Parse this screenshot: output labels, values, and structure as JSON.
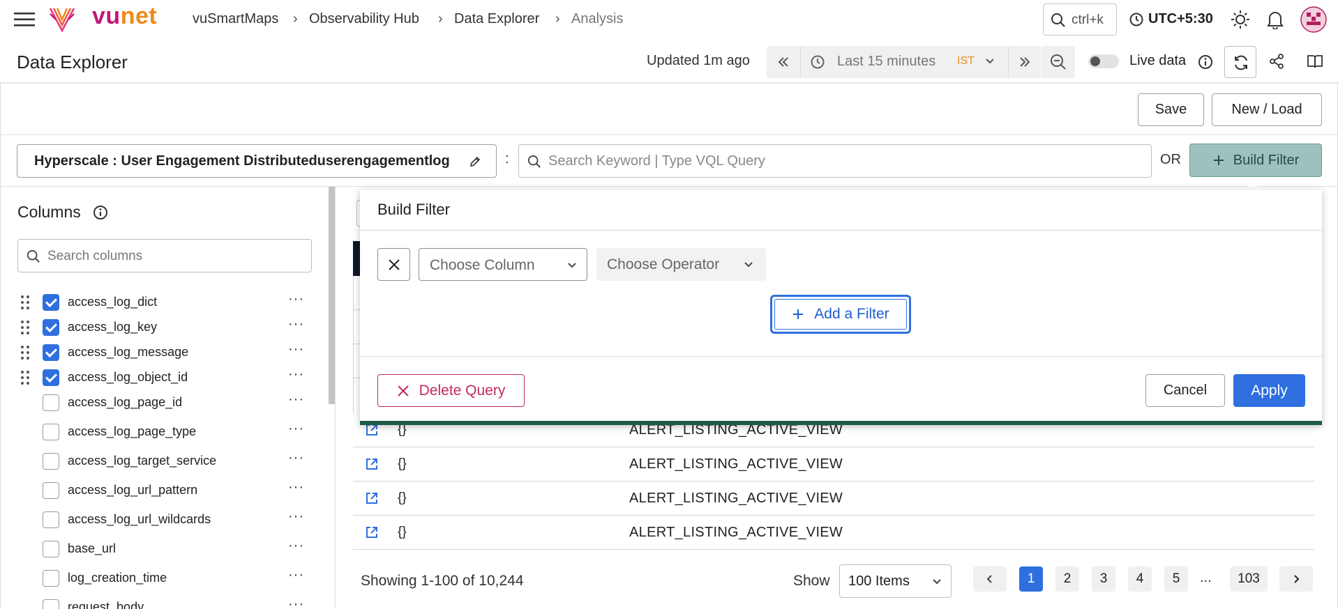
{
  "app": {
    "logo": "vunet",
    "breadcrumb": [
      "vuSmartMaps",
      "Observability Hub",
      "Data Explorer",
      "Analysis"
    ],
    "search_shortcut": "ctrl+k",
    "timezone": "UTC+5:30"
  },
  "header": {
    "title": "Data Explorer",
    "updated": "Updated 1m ago",
    "time_range": "Last 15 minutes",
    "tz_badge": "IST",
    "live_data_label": "Live data"
  },
  "toolbar": {
    "save_label": "Save",
    "new_load_label": "New / Load"
  },
  "query": {
    "datasource": "Hyperscale : User Engagement Distributeduserengagementlog",
    "separator": ":",
    "search_placeholder": "Search Keyword | Type VQL Query",
    "or_label": "OR",
    "build_filter_label": "Build Filter"
  },
  "sidebar": {
    "title": "Columns",
    "search_placeholder": "Search columns",
    "columns": [
      {
        "name": "access_log_dict",
        "checked": true
      },
      {
        "name": "access_log_key",
        "checked": true
      },
      {
        "name": "access_log_message",
        "checked": true
      },
      {
        "name": "access_log_object_id",
        "checked": true
      },
      {
        "name": "access_log_page_id",
        "checked": false
      },
      {
        "name": "access_log_page_type",
        "checked": false
      },
      {
        "name": "access_log_target_service",
        "checked": false
      },
      {
        "name": "access_log_url_pattern",
        "checked": false
      },
      {
        "name": "access_log_url_wildcards",
        "checked": false
      },
      {
        "name": "base_url",
        "checked": false
      },
      {
        "name": "log_creation_time",
        "checked": false
      },
      {
        "name": "request_body",
        "checked": false
      }
    ]
  },
  "table": {
    "rows": [
      {
        "c1": "{}",
        "c2": "ALERT_LISTING_ACTIVE_VIEW"
      },
      {
        "c1": "{}",
        "c2": "ALERT_LISTING_ACTIVE_VIEW"
      },
      {
        "c1": "{}",
        "c2": "ALERT_LISTING_ACTIVE_VIEW"
      },
      {
        "c1": "{}",
        "c2": "ALERT_LISTING_ACTIVE_VIEW"
      }
    ]
  },
  "pagination": {
    "showing": "Showing 1-100 of 10,244",
    "show_label": "Show",
    "page_size": "100 Items",
    "pages": [
      "1",
      "2",
      "3",
      "4",
      "5"
    ],
    "ellipsis": "...",
    "last_page": "103",
    "current_page": "1"
  },
  "modal": {
    "title": "Build Filter",
    "column_placeholder": "Choose Column",
    "operator_placeholder": "Choose Operator",
    "add_filter_label": "Add a Filter",
    "delete_query_label": "Delete Query",
    "cancel_label": "Cancel",
    "apply_label": "Apply"
  },
  "colors": {
    "accent": "#2f6fe0",
    "build_filter_bg": "#9ec1bd",
    "delete": "#c22a5a",
    "modal_border": "#1d5a4a",
    "logo_vu": "#c2187a",
    "logo_net": "#f08a1c"
  }
}
